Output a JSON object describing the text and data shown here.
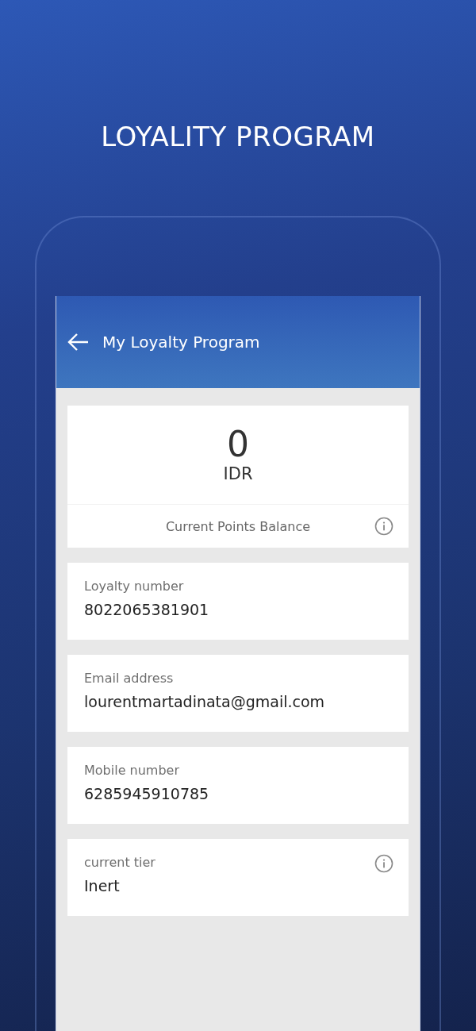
{
  "headline": "LOYALITY PROGRAM",
  "app_bar": {
    "title": "My Loyalty Program"
  },
  "balance": {
    "amount": "0",
    "currency": "IDR",
    "label": "Current Points Balance"
  },
  "fields": [
    {
      "label": "Loyalty number",
      "value": "8022065381901",
      "info_icon": false
    },
    {
      "label": "Email address",
      "value": "lourentmartadinata@gmail.com",
      "info_icon": false
    },
    {
      "label": "Mobile number",
      "value": "6285945910785",
      "info_icon": false
    },
    {
      "label": "current tier",
      "value": "Inert",
      "info_icon": true
    }
  ]
}
